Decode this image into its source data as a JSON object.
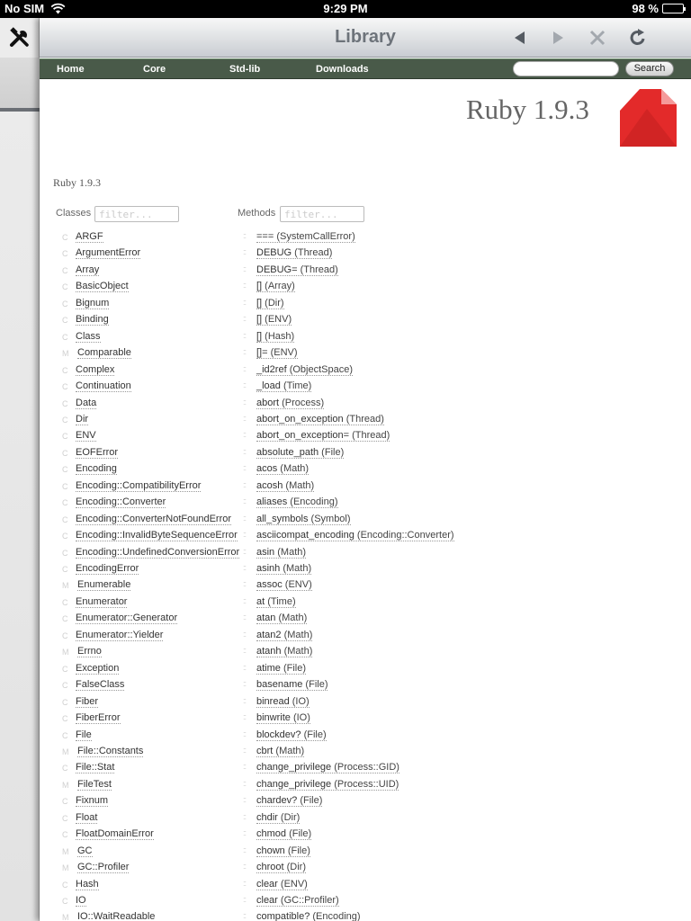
{
  "status_bar": {
    "carrier": "No SIM",
    "time": "9:29 PM",
    "battery": "98 %",
    "battery_level": 0.98
  },
  "toolbar": {
    "title": "Library"
  },
  "nav": {
    "links": [
      "Home",
      "Core",
      "Std-lib",
      "Downloads"
    ],
    "search_value": "",
    "search_button": "Search"
  },
  "header": {
    "title": "Ruby 1.9.3",
    "logo_color": "#e32a2a"
  },
  "page": {
    "subtitle": "Ruby 1.9.3"
  },
  "classes": {
    "label": "Classes",
    "filter_placeholder": "filter...",
    "items": [
      {
        "kind": "C",
        "name": "ARGF"
      },
      {
        "kind": "C",
        "name": "ArgumentError"
      },
      {
        "kind": "C",
        "name": "Array"
      },
      {
        "kind": "C",
        "name": "BasicObject"
      },
      {
        "kind": "C",
        "name": "Bignum"
      },
      {
        "kind": "C",
        "name": "Binding"
      },
      {
        "kind": "C",
        "name": "Class"
      },
      {
        "kind": "M",
        "name": "Comparable"
      },
      {
        "kind": "C",
        "name": "Complex"
      },
      {
        "kind": "C",
        "name": "Continuation"
      },
      {
        "kind": "C",
        "name": "Data"
      },
      {
        "kind": "C",
        "name": "Dir"
      },
      {
        "kind": "C",
        "name": "ENV"
      },
      {
        "kind": "C",
        "name": "EOFError"
      },
      {
        "kind": "C",
        "name": "Encoding"
      },
      {
        "kind": "C",
        "name": "Encoding::CompatibilityError"
      },
      {
        "kind": "C",
        "name": "Encoding::Converter"
      },
      {
        "kind": "C",
        "name": "Encoding::ConverterNotFoundError"
      },
      {
        "kind": "C",
        "name": "Encoding::InvalidByteSequenceError"
      },
      {
        "kind": "C",
        "name": "Encoding::UndefinedConversionError"
      },
      {
        "kind": "C",
        "name": "EncodingError"
      },
      {
        "kind": "M",
        "name": "Enumerable"
      },
      {
        "kind": "C",
        "name": "Enumerator"
      },
      {
        "kind": "C",
        "name": "Enumerator::Generator"
      },
      {
        "kind": "C",
        "name": "Enumerator::Yielder"
      },
      {
        "kind": "M",
        "name": "Errno"
      },
      {
        "kind": "C",
        "name": "Exception"
      },
      {
        "kind": "C",
        "name": "FalseClass"
      },
      {
        "kind": "C",
        "name": "Fiber"
      },
      {
        "kind": "C",
        "name": "FiberError"
      },
      {
        "kind": "C",
        "name": "File"
      },
      {
        "kind": "M",
        "name": "File::Constants"
      },
      {
        "kind": "C",
        "name": "File::Stat"
      },
      {
        "kind": "M",
        "name": "FileTest"
      },
      {
        "kind": "C",
        "name": "Fixnum"
      },
      {
        "kind": "C",
        "name": "Float"
      },
      {
        "kind": "C",
        "name": "FloatDomainError"
      },
      {
        "kind": "M",
        "name": "GC"
      },
      {
        "kind": "M",
        "name": "GC::Profiler"
      },
      {
        "kind": "C",
        "name": "Hash"
      },
      {
        "kind": "C",
        "name": "IO"
      },
      {
        "kind": "M",
        "name": "IO::WaitReadable"
      }
    ]
  },
  "methods": {
    "label": "Methods",
    "filter_placeholder": "filter...",
    "marker": "::",
    "items": [
      {
        "name": "===",
        "owner": "(SystemCallError)"
      },
      {
        "name": "DEBUG",
        "owner": "(Thread)"
      },
      {
        "name": "DEBUG=",
        "owner": "(Thread)"
      },
      {
        "name": "[]",
        "owner": "(Array)"
      },
      {
        "name": "[]",
        "owner": "(Dir)"
      },
      {
        "name": "[]",
        "owner": "(ENV)"
      },
      {
        "name": "[]",
        "owner": "(Hash)"
      },
      {
        "name": "[]=",
        "owner": "(ENV)"
      },
      {
        "name": "_id2ref",
        "owner": "(ObjectSpace)"
      },
      {
        "name": "_load",
        "owner": "(Time)"
      },
      {
        "name": "abort",
        "owner": "(Process)"
      },
      {
        "name": "abort_on_exception",
        "owner": "(Thread)"
      },
      {
        "name": "abort_on_exception=",
        "owner": "(Thread)"
      },
      {
        "name": "absolute_path",
        "owner": "(File)"
      },
      {
        "name": "acos",
        "owner": "(Math)"
      },
      {
        "name": "acosh",
        "owner": "(Math)"
      },
      {
        "name": "aliases",
        "owner": "(Encoding)"
      },
      {
        "name": "all_symbols",
        "owner": "(Symbol)"
      },
      {
        "name": "asciicompat_encoding",
        "owner": "(Encoding::Converter)"
      },
      {
        "name": "asin",
        "owner": "(Math)"
      },
      {
        "name": "asinh",
        "owner": "(Math)"
      },
      {
        "name": "assoc",
        "owner": "(ENV)"
      },
      {
        "name": "at",
        "owner": "(Time)"
      },
      {
        "name": "atan",
        "owner": "(Math)"
      },
      {
        "name": "atan2",
        "owner": "(Math)"
      },
      {
        "name": "atanh",
        "owner": "(Math)"
      },
      {
        "name": "atime",
        "owner": "(File)"
      },
      {
        "name": "basename",
        "owner": "(File)"
      },
      {
        "name": "binread",
        "owner": "(IO)"
      },
      {
        "name": "binwrite",
        "owner": "(IO)"
      },
      {
        "name": "blockdev?",
        "owner": "(File)"
      },
      {
        "name": "cbrt",
        "owner": "(Math)"
      },
      {
        "name": "change_privilege",
        "owner": "(Process::GID)"
      },
      {
        "name": "change_privilege",
        "owner": "(Process::UID)"
      },
      {
        "name": "chardev?",
        "owner": "(File)"
      },
      {
        "name": "chdir",
        "owner": "(Dir)"
      },
      {
        "name": "chmod",
        "owner": "(File)"
      },
      {
        "name": "chown",
        "owner": "(File)"
      },
      {
        "name": "chroot",
        "owner": "(Dir)"
      },
      {
        "name": "clear",
        "owner": "(ENV)"
      },
      {
        "name": "clear",
        "owner": "(GC::Profiler)"
      },
      {
        "name": "compatible?",
        "owner": "(Encoding)"
      }
    ]
  }
}
